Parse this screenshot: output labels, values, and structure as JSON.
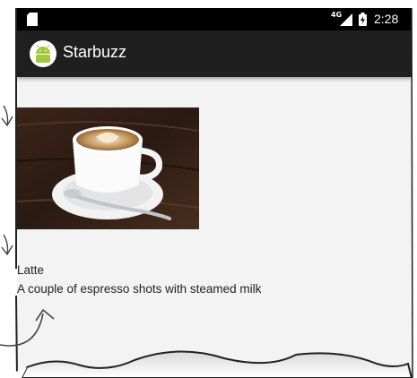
{
  "status_bar": {
    "network_label": "4G",
    "time": "2:28"
  },
  "app_bar": {
    "title": "Starbuzz",
    "icon": "android-icon"
  },
  "drink": {
    "image_icon": "latte-photo",
    "name": "Latte",
    "description": "A couple of espresso shots with steamed milk"
  },
  "colors": {
    "status_bar": "#000000",
    "app_bar": "#1f1f1f",
    "background": "#f3f3f3",
    "android_green": "#a4c639",
    "app_icon_bg": "#ffffff"
  }
}
